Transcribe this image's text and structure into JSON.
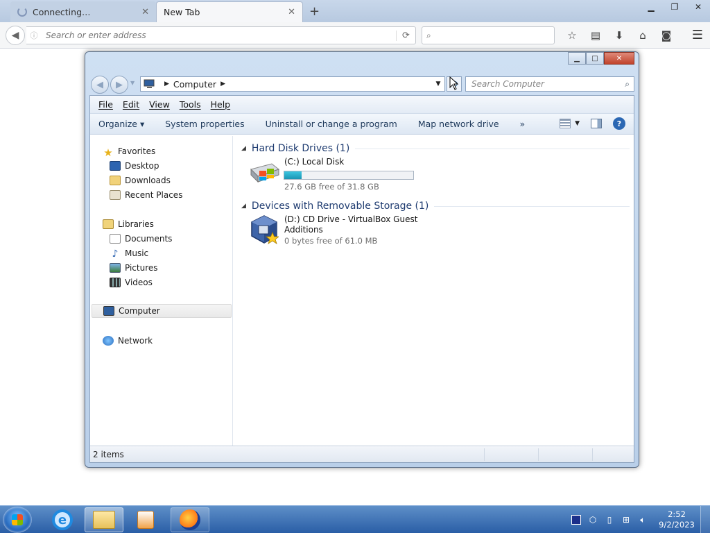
{
  "browser": {
    "tabs": [
      {
        "label": "Connecting…",
        "state": "loading"
      },
      {
        "label": "New Tab",
        "state": "active"
      }
    ],
    "address_placeholder": "Search or enter address",
    "search_placeholder": ""
  },
  "explorer": {
    "breadcrumb": [
      "Computer"
    ],
    "search_placeholder": "Search Computer",
    "menu": [
      "File",
      "Edit",
      "View",
      "Tools",
      "Help"
    ],
    "commands": [
      "Organize ▾",
      "System properties",
      "Uninstall or change a program",
      "Map network drive",
      "»"
    ],
    "nav": {
      "favorites": "Favorites",
      "favorite_items": [
        "Desktop",
        "Downloads",
        "Recent Places"
      ],
      "libraries": "Libraries",
      "library_items": [
        "Documents",
        "Music",
        "Pictures",
        "Videos"
      ],
      "computer": "Computer",
      "network": "Network"
    },
    "groups": {
      "hdd_header": "Hard Disk Drives (1)",
      "removable_header": "Devices with Removable Storage (1)"
    },
    "drives": {
      "c_label": "(C:) Local Disk",
      "c_free": "27.6 GB free of 31.8 GB",
      "c_used_fraction": 0.132,
      "d_label_1": "(D:) CD Drive - VirtualBox Guest",
      "d_label_2": "Additions",
      "d_free": "0 bytes free of 61.0 MB"
    },
    "status": "2 items"
  },
  "taskbar": {
    "time": "2:52",
    "date": "9/2/2023"
  }
}
